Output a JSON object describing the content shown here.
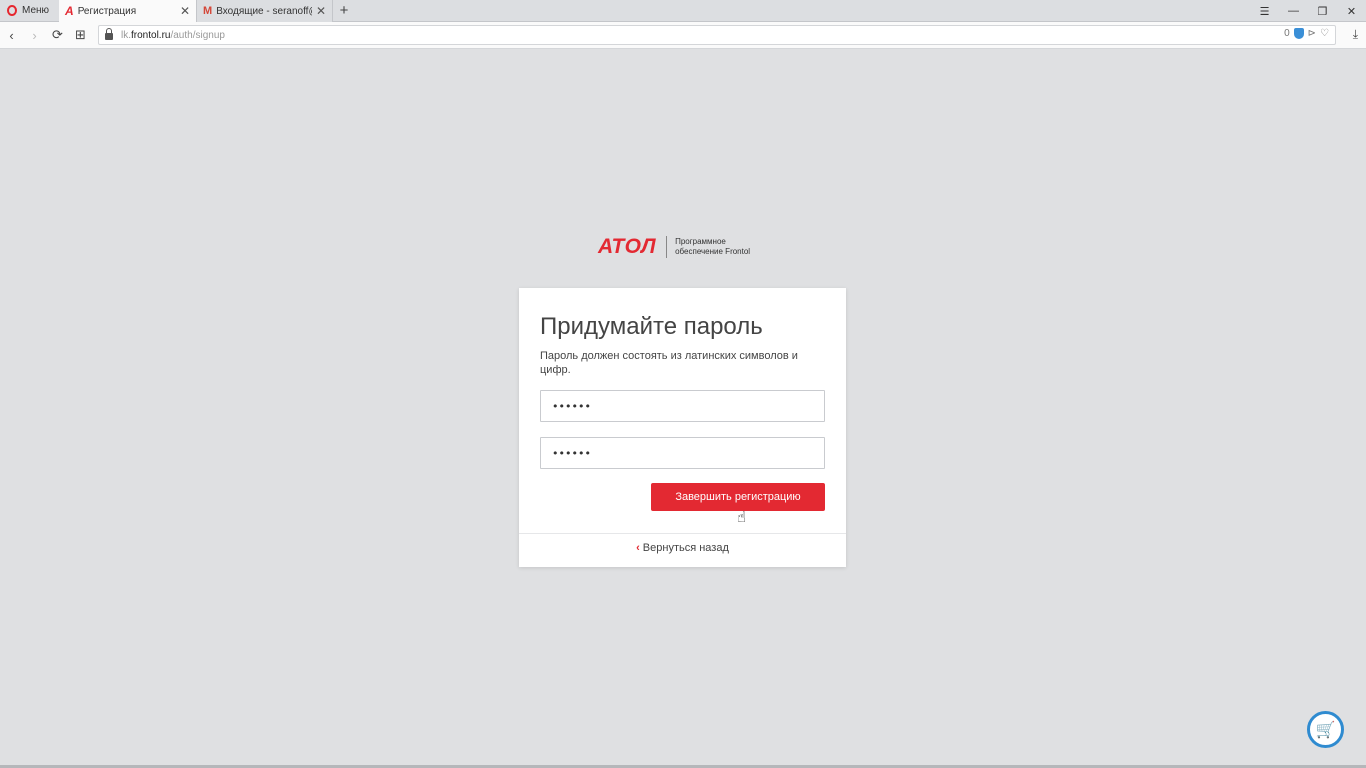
{
  "browser": {
    "menu_label": "Меню",
    "tabs": [
      {
        "label": "Регистрация",
        "favicon": "А",
        "active": true
      },
      {
        "label": "Входящие - seranoff@gm",
        "favicon": "M",
        "active": false
      }
    ],
    "newtab_symbol": "+",
    "window_controls": {
      "tabs_menu": "☰",
      "minimize": "—",
      "restore": "❐",
      "close": "✕"
    },
    "nav": {
      "back": "‹",
      "forward": "›",
      "reload": "⟳",
      "speed_dial": "⊞"
    },
    "address": {
      "prefix": "lk.",
      "host": "frontol.ru",
      "path": "/auth/signup",
      "badge_count": "0"
    },
    "download": "⤓"
  },
  "logo": {
    "mark": "АТОЛ",
    "line1": "Программное",
    "line2": "обеспечение Frontol"
  },
  "form": {
    "title": "Придумайте пароль",
    "hint": "Пароль должен состоять из латинских символов и цифр.",
    "password1_value": "••••••",
    "password2_value": "••••••",
    "submit_label": "Завершить регистрацию",
    "back_label": "Вернуться назад",
    "back_chevron": "‹"
  },
  "colors": {
    "accent": "#e32932",
    "background": "#dfe0e2",
    "cart": "#2f8bd0"
  },
  "widget": {
    "cart_icon": "🛒"
  }
}
